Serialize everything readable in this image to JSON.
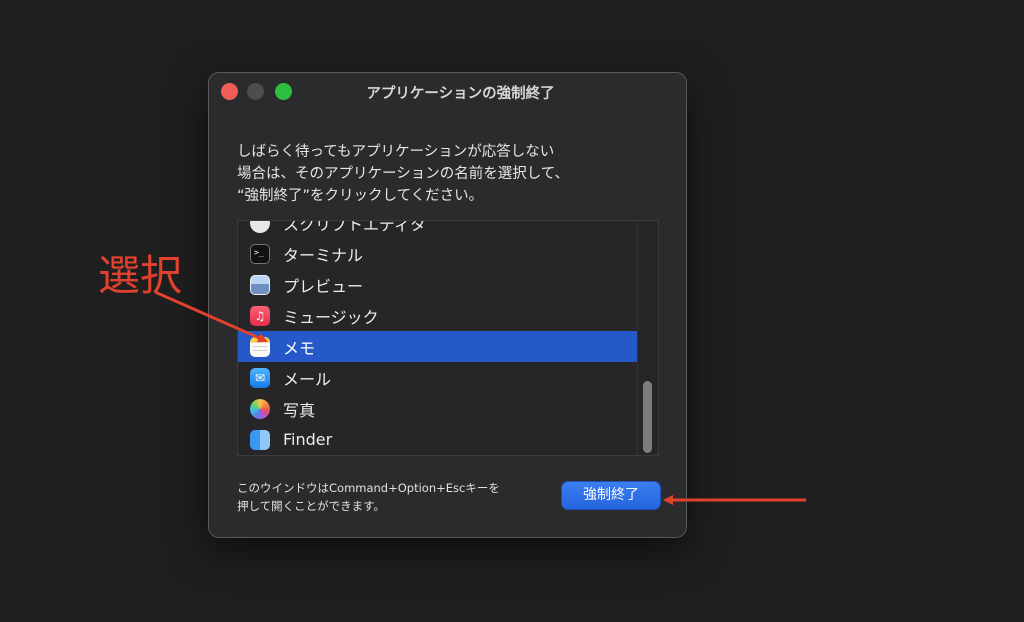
{
  "window": {
    "title": "アプリケーションの強制終了",
    "description_lines": [
      "しばらく待ってもアプリケーションが応答しない",
      "場合は、そのアプリケーションの名前を選択して、",
      "“強制終了”をクリックしてください。"
    ]
  },
  "app_list": {
    "items": [
      {
        "label": "スクリプトエディタ",
        "icon": "script-editor-icon"
      },
      {
        "label": "ターミナル",
        "icon": "terminal-icon"
      },
      {
        "label": "プレビュー",
        "icon": "preview-icon"
      },
      {
        "label": "ミュージック",
        "icon": "music-icon"
      },
      {
        "label": "メモ",
        "icon": "notes-icon",
        "selected": true
      },
      {
        "label": "メール",
        "icon": "mail-icon"
      },
      {
        "label": "写真",
        "icon": "photos-icon"
      },
      {
        "label": "Finder",
        "icon": "finder-icon"
      }
    ],
    "selected_color": "#2559c9"
  },
  "footer": {
    "hint_lines": [
      "このウインドウはCommand+Option+Escキーを",
      "押して開くことができます。"
    ],
    "button_label": "強制終了"
  },
  "annotation": {
    "label": "選択",
    "color": "#e1422f"
  }
}
